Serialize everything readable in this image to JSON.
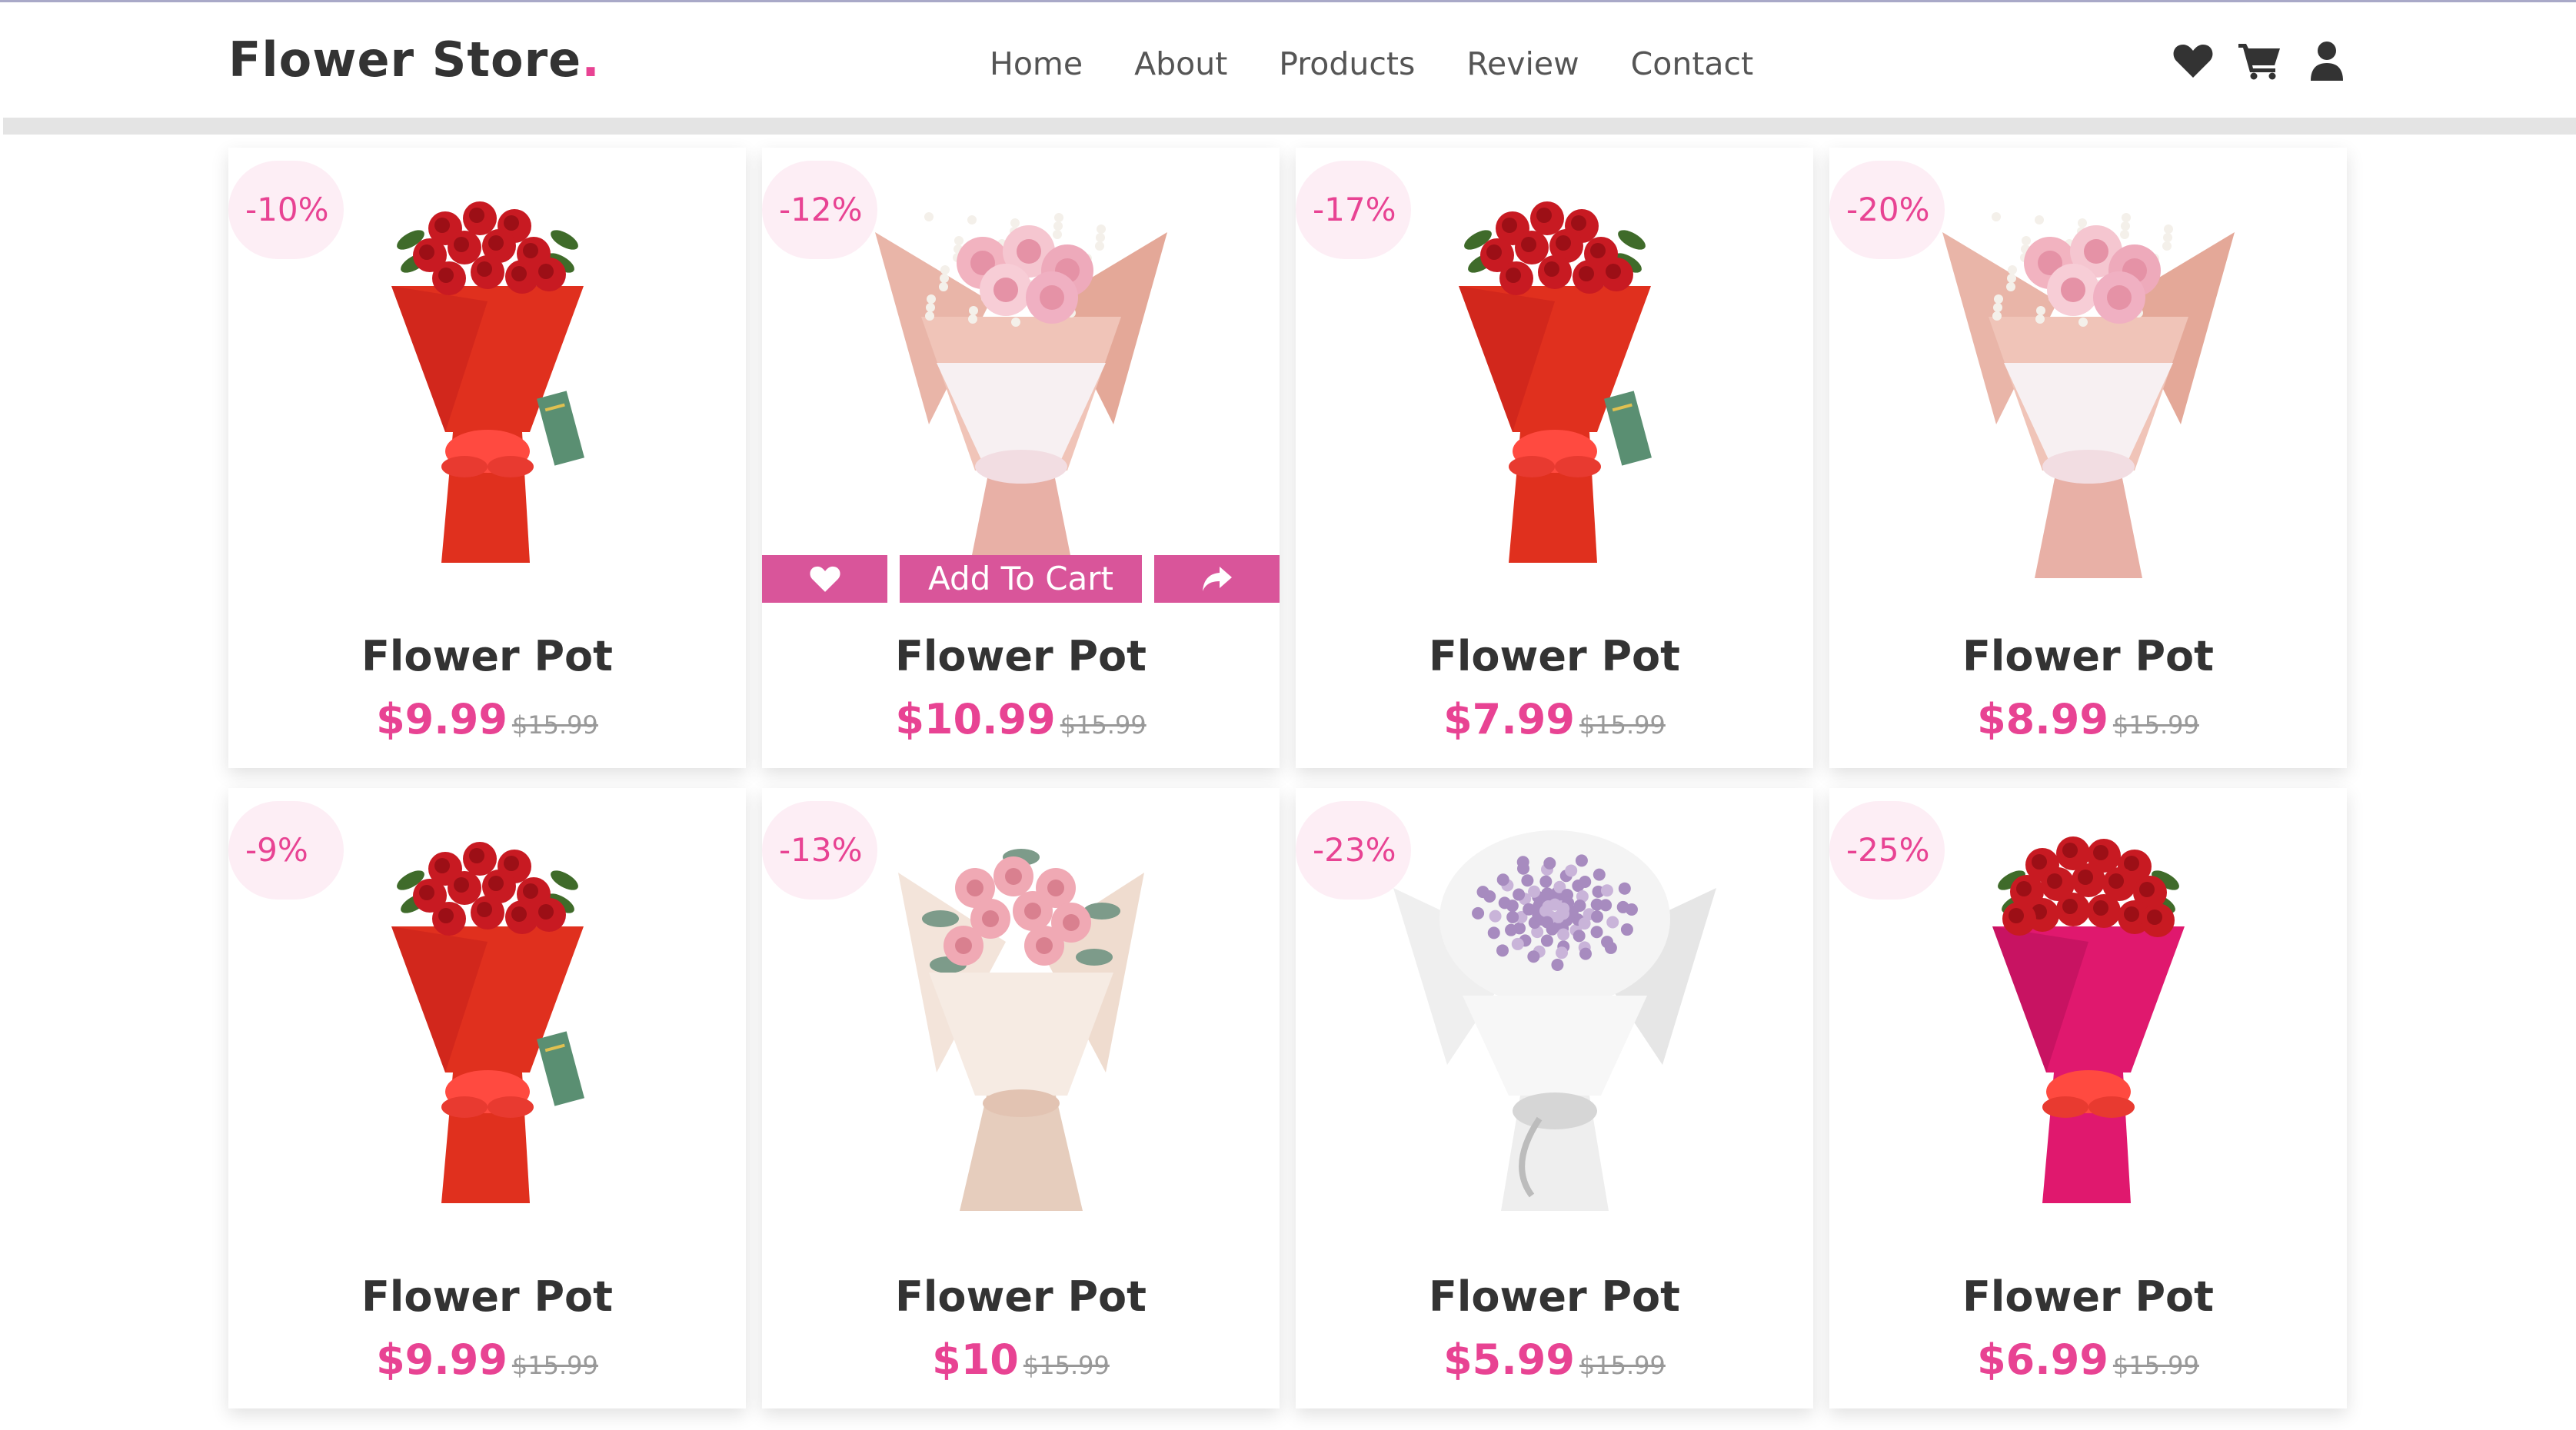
{
  "brand": {
    "name": "Flower Store",
    "dot": "."
  },
  "nav": [
    "Home",
    "About",
    "Products",
    "Review",
    "Contact"
  ],
  "header_icons": [
    "heart-icon",
    "cart-icon",
    "user-icon"
  ],
  "colors": {
    "accent": "#e84393",
    "action_bar": "#d9559a",
    "badge_bg": "#fdeef5",
    "text": "#333333"
  },
  "actions": {
    "add_to_cart": "Add To Cart",
    "wishlist_icon": "heart-icon",
    "share_icon": "share-icon"
  },
  "products": [
    {
      "discount": "-10%",
      "name": "Flower Pot",
      "price": "$9.99",
      "old_price": "$15.99",
      "image": "red-rose-bouquet",
      "show_actions": false
    },
    {
      "discount": "-12%",
      "name": "Flower Pot",
      "price": "$10.99",
      "old_price": "$15.99",
      "image": "pink-carnation-bouquet",
      "show_actions": true
    },
    {
      "discount": "-17%",
      "name": "Flower Pot",
      "price": "$7.99",
      "old_price": "$15.99",
      "image": "red-rose-bouquet",
      "show_actions": false
    },
    {
      "discount": "-20%",
      "name": "Flower Pot",
      "price": "$8.99",
      "old_price": "$15.99",
      "image": "pink-carnation-bouquet",
      "show_actions": false
    },
    {
      "discount": "-9%",
      "name": "Flower Pot",
      "price": "$9.99",
      "old_price": "$15.99",
      "image": "red-rose-bouquet",
      "show_actions": false
    },
    {
      "discount": "-13%",
      "name": "Flower Pot",
      "price": "$10",
      "old_price": "$15.99",
      "image": "pink-rose-bouquet",
      "show_actions": false
    },
    {
      "discount": "-23%",
      "name": "Flower Pot",
      "price": "$5.99",
      "old_price": "$15.99",
      "image": "purple-gypsophila-bouquet",
      "show_actions": false
    },
    {
      "discount": "-25%",
      "name": "Flower Pot",
      "price": "$6.99",
      "old_price": "$15.99",
      "image": "red-rose-magenta-bouquet",
      "show_actions": false
    }
  ]
}
